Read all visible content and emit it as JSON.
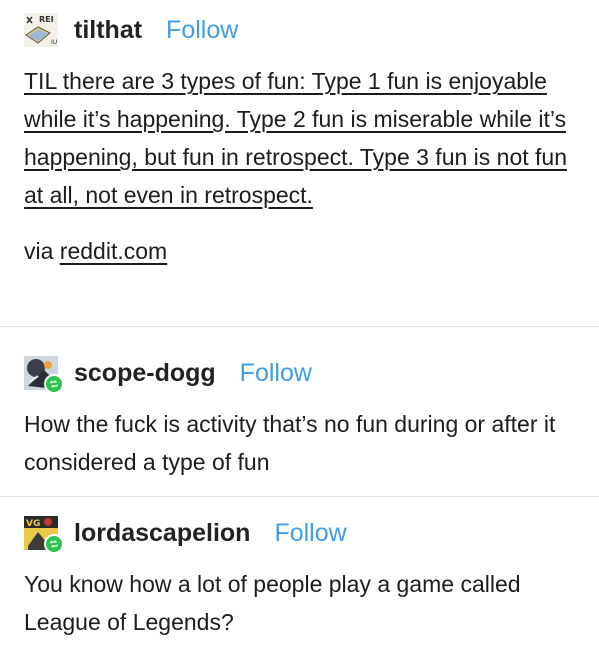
{
  "posts": [
    {
      "username": "tilthat",
      "follow_label": "Follow",
      "body": "TIL there are 3 types of fun: Type 1 fun is enjoyable while it’s happening. Type 2 fun is miserable while it’s happening, but fun in retrospect. Type 3 fun is not fun at all, not even in retrospect.",
      "via_prefix": "via ",
      "via_link": "reddit.com",
      "avatar_icon": "til-book-avatar-icon"
    },
    {
      "username": "scope-dogg",
      "follow_label": "Follow",
      "body": "How the fuck is activity that’s no fun during or after it considered a type of fun",
      "avatar_icon": "scope-dogg-avatar-icon",
      "badge_icon": "reblog-icon"
    },
    {
      "username": "lordascapelion",
      "follow_label": "Follow",
      "body": "You know how a lot of people play a game called League of Legends?",
      "avatar_icon": "lordascapelion-avatar-icon",
      "badge_icon": "reblog-icon"
    }
  ],
  "colors": {
    "follow": "#3f9ee8",
    "text": "#1d1d1d",
    "divider": "#e2e2e2",
    "reblog_badge": "#2cc34f"
  }
}
